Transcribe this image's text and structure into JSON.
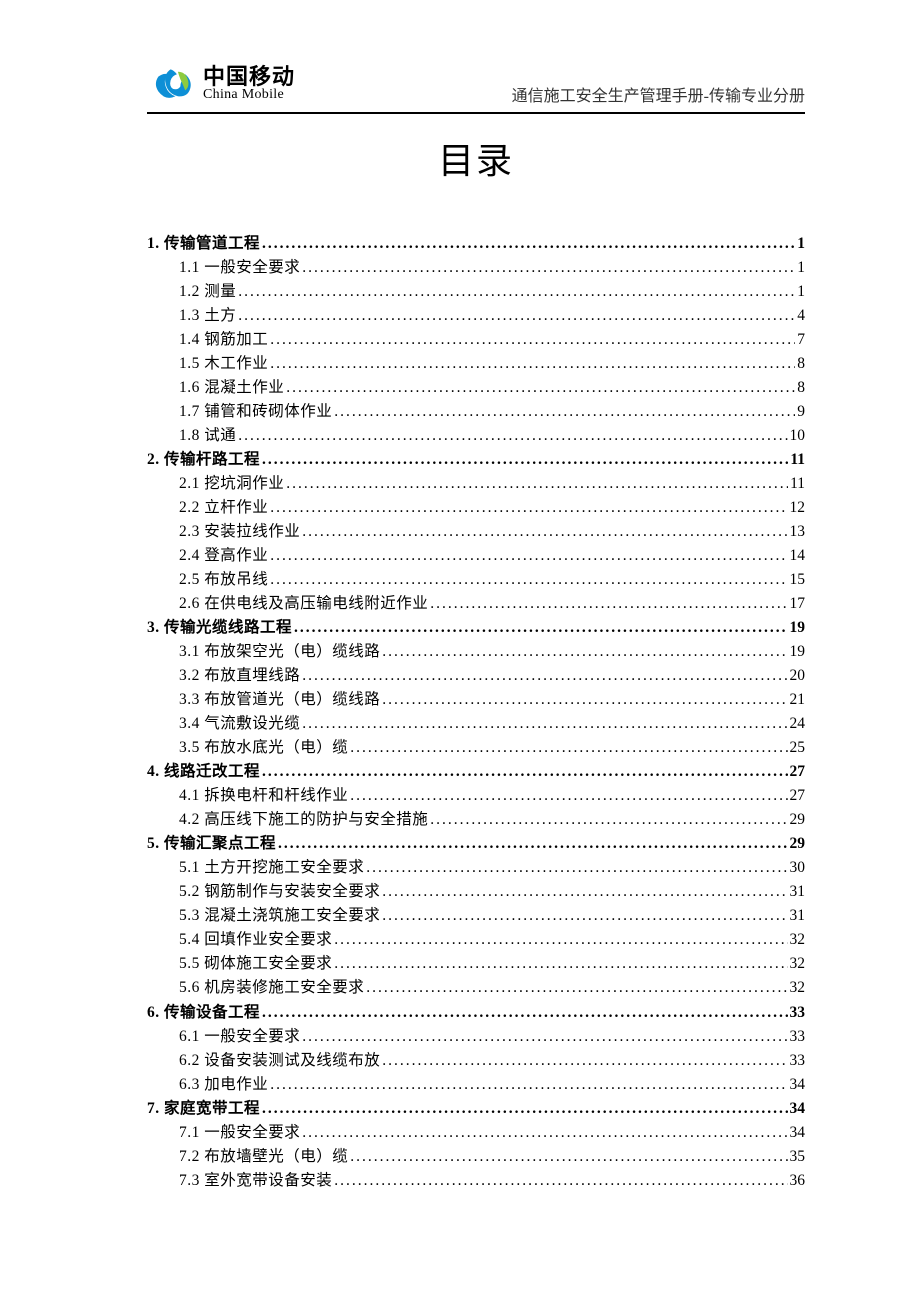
{
  "logo": {
    "cn": "中国移动",
    "en": "China Mobile"
  },
  "header_title": "通信施工安全生产管理手册-传输专业分册",
  "doc_title": "目录",
  "toc": [
    {
      "level": 1,
      "label": "1. 传输管道工程",
      "page": "1"
    },
    {
      "level": 2,
      "label": "1.1 一般安全要求",
      "page": "1"
    },
    {
      "level": 2,
      "label": "1.2 测量",
      "page": "1"
    },
    {
      "level": 2,
      "label": "1.3 土方",
      "page": "4"
    },
    {
      "level": 2,
      "label": "1.4 钢筋加工",
      "page": "7"
    },
    {
      "level": 2,
      "label": "1.5 木工作业",
      "page": "8"
    },
    {
      "level": 2,
      "label": "1.6 混凝土作业",
      "page": "8"
    },
    {
      "level": 2,
      "label": "1.7 铺管和砖砌体作业",
      "page": "9"
    },
    {
      "level": 2,
      "label": "1.8 试通",
      "page": "10"
    },
    {
      "level": 1,
      "label": "2. 传输杆路工程",
      "page": "11"
    },
    {
      "level": 2,
      "label": "2.1 挖坑洞作业",
      "page": "11"
    },
    {
      "level": 2,
      "label": "2.2 立杆作业",
      "page": "12"
    },
    {
      "level": 2,
      "label": "2.3 安装拉线作业",
      "page": "13"
    },
    {
      "level": 2,
      "label": "2.4 登高作业",
      "page": "14"
    },
    {
      "level": 2,
      "label": "2.5 布放吊线",
      "page": "15"
    },
    {
      "level": 2,
      "label": "2.6 在供电线及高压输电线附近作业",
      "page": "17"
    },
    {
      "level": 1,
      "label": "3. 传输光缆线路工程",
      "page": "19"
    },
    {
      "level": 2,
      "label": "3.1 布放架空光（电）缆线路",
      "page": "19"
    },
    {
      "level": 2,
      "label": "3.2 布放直埋线路",
      "page": "20"
    },
    {
      "level": 2,
      "label": "3.3 布放管道光（电）缆线路",
      "page": "21"
    },
    {
      "level": 2,
      "label": "3.4 气流敷设光缆",
      "page": "24"
    },
    {
      "level": 2,
      "label": "3.5 布放水底光（电）缆",
      "page": "25"
    },
    {
      "level": 1,
      "label": "4. 线路迁改工程",
      "page": "27"
    },
    {
      "level": 2,
      "label": "4.1 拆换电杆和杆线作业",
      "page": "27"
    },
    {
      "level": 2,
      "label": "4.2 高压线下施工的防护与安全措施",
      "page": "29"
    },
    {
      "level": 1,
      "label": "5. 传输汇聚点工程",
      "page": "29"
    },
    {
      "level": 2,
      "label": "5.1 土方开挖施工安全要求",
      "page": "30"
    },
    {
      "level": 2,
      "label": "5.2 钢筋制作与安装安全要求",
      "page": "31"
    },
    {
      "level": 2,
      "label": "5.3 混凝土浇筑施工安全要求",
      "page": "31"
    },
    {
      "level": 2,
      "label": "5.4 回填作业安全要求",
      "page": "32"
    },
    {
      "level": 2,
      "label": "5.5 砌体施工安全要求",
      "page": "32"
    },
    {
      "level": 2,
      "label": "5.6 机房装修施工安全要求",
      "page": "32"
    },
    {
      "level": 1,
      "label": "6. 传输设备工程",
      "page": "33"
    },
    {
      "level": 2,
      "label": "6.1 一般安全要求",
      "page": "33"
    },
    {
      "level": 2,
      "label": "6.2 设备安装测试及线缆布放",
      "page": "33"
    },
    {
      "level": 2,
      "label": "6.3 加电作业",
      "page": "34"
    },
    {
      "level": 1,
      "label": "7. 家庭宽带工程",
      "page": "34"
    },
    {
      "level": 2,
      "label": "7.1 一般安全要求",
      "page": "34"
    },
    {
      "level": 2,
      "label": "7.2 布放墙壁光（电）缆",
      "page": "35"
    },
    {
      "level": 2,
      "label": "7.3 室外宽带设备安装",
      "page": "36"
    }
  ]
}
